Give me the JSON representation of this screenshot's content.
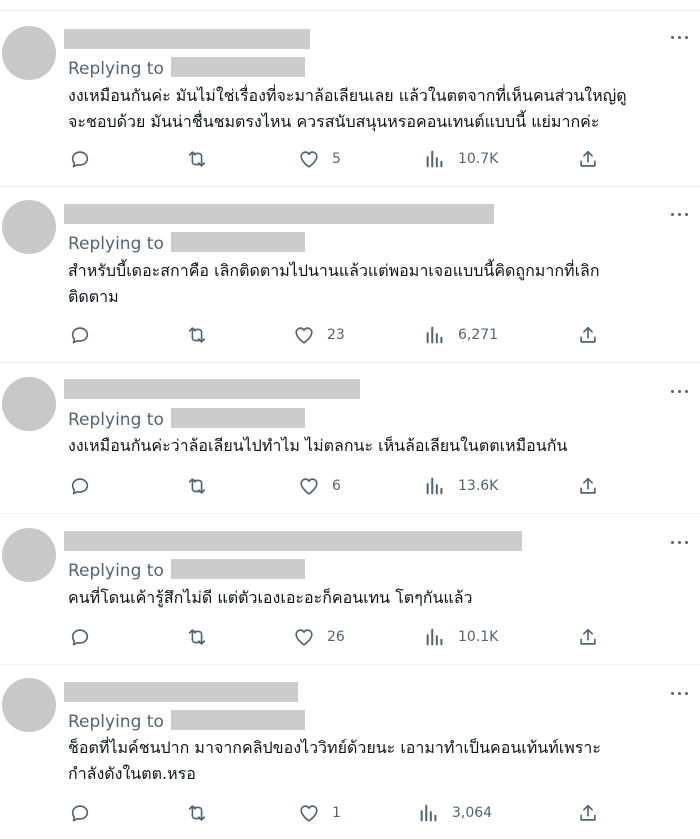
{
  "tweets": [
    {
      "replying_label": "Replying to",
      "text_lines": [
        "งงเหมือนกันค่ะ มันไม่ใช่เรื่องที่จะมาล้อเลียนเลย แล้วในตตจากที่เห็นคนส่วนใหญ่ดู",
        "จะชอบด้วย มันน่าชื่นชมตรงไหน ควรสนับสนุนหรอคอนเทนต์แบบนี้ แย่มากค่ะ"
      ],
      "likes": "5",
      "views": "10.7K"
    },
    {
      "replying_label": "Replying to",
      "text_lines": [
        "สำหรับบี้เดอะสกาคือ เลิกติดตามไปนานแล้วแต่พอมาเจอแบบนี้คิดถูกมากที่เลิก",
        "ติดตาม"
      ],
      "likes": "23",
      "views": "6,271"
    },
    {
      "replying_label": "Replying to",
      "text_lines": [
        "งงเหมือนกันค่ะว่าล้อเลียนไปทำไม ไม่ตลกนะ เห็นล้อเลียนในตตเหมือนกัน"
      ],
      "likes": "6",
      "views": "13.6K"
    },
    {
      "replying_label": "Replying to",
      "text_lines": [
        "คนที่โดนเค้ารู้สึกไม่ดี แต่ตัวเองเอะอะก็คอนเทน โตๆกันแล้ว"
      ],
      "likes": "26",
      "views": "10.1K"
    },
    {
      "replying_label": "Replying to",
      "text_lines": [
        "ช็อตที่ไมค์ชนปาก มาจากคลิปของไววิทย์ด้วยนะ เอามาทำเป็นคอนเท้นท์เพราะ",
        "กำลังดังในตต.หรอ"
      ],
      "likes": "1",
      "views": "3,064"
    }
  ],
  "icons": {
    "reply": "reply-icon",
    "retweet": "retweet-icon",
    "like": "heart-icon",
    "views": "views-icon",
    "share": "share-icon",
    "more": "more-dots-icon"
  },
  "colors": {
    "icon_gray": "#536471",
    "redacted": "#cccccc",
    "avatar": "#c8c8c8",
    "divider": "#eff3f4"
  }
}
